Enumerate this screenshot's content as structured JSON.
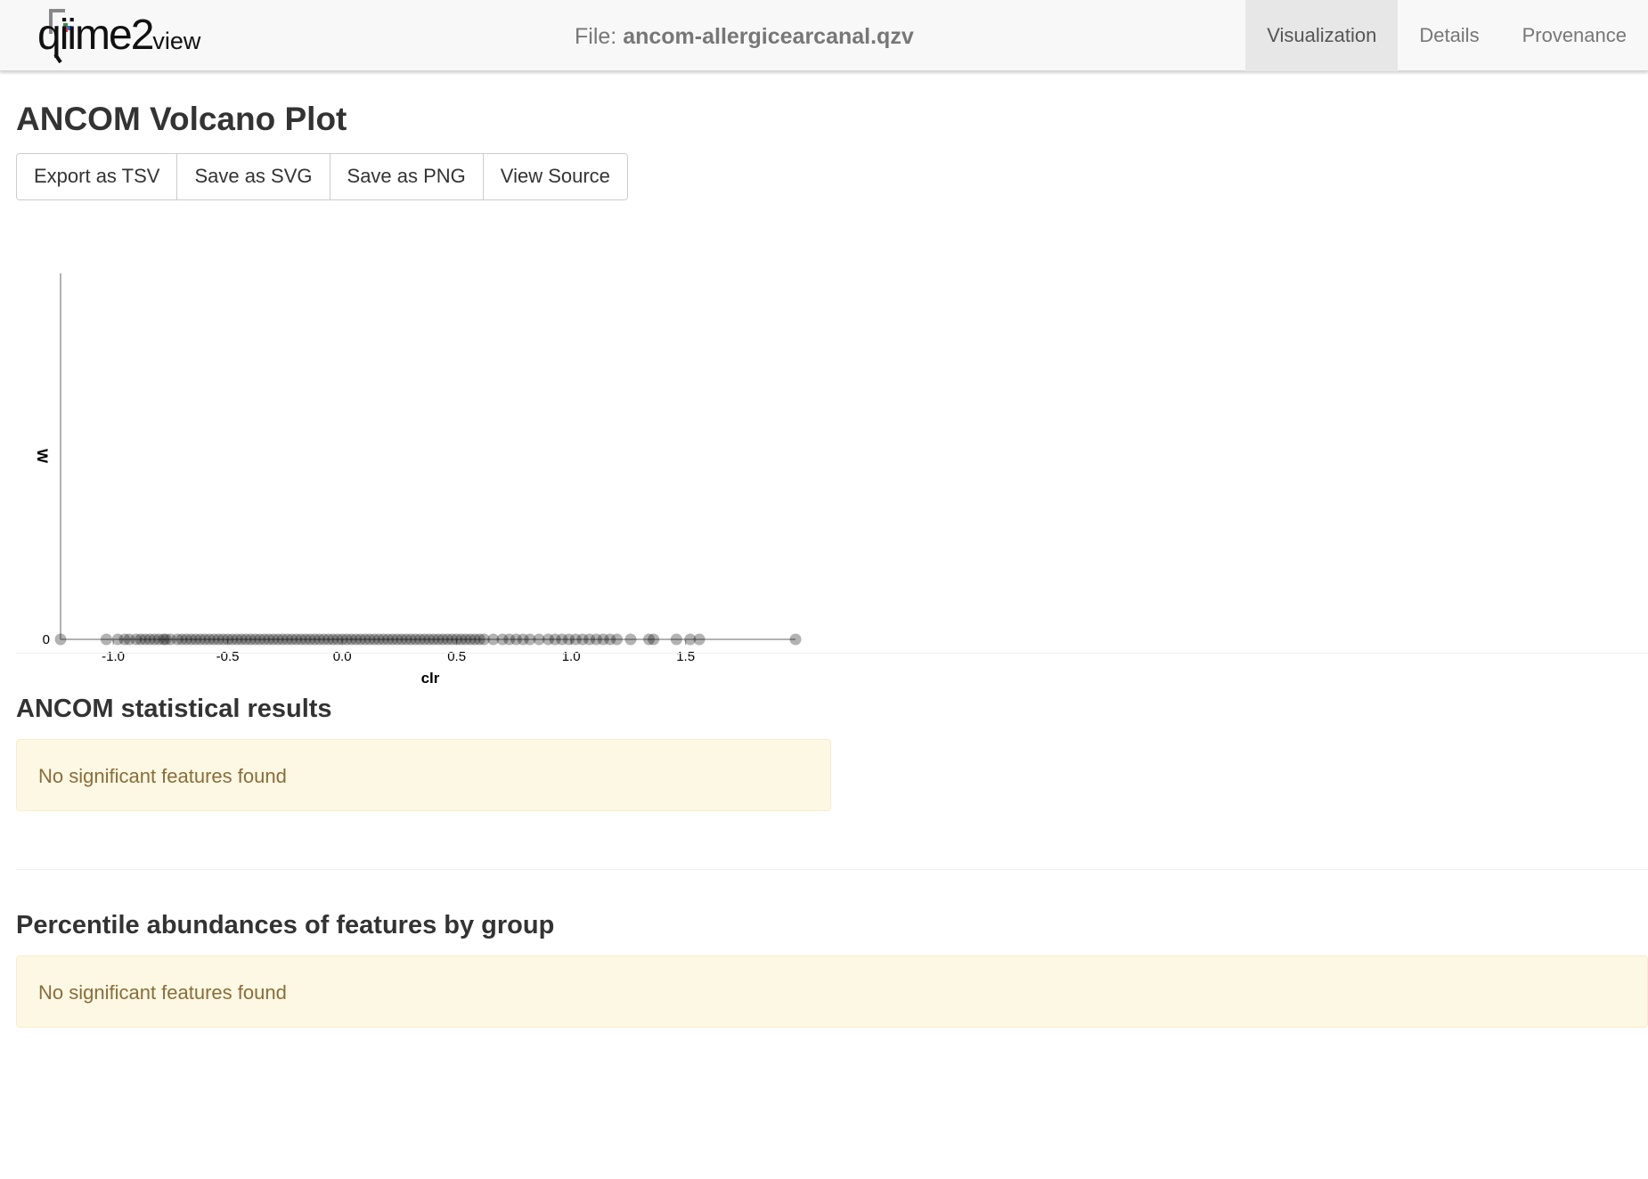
{
  "header": {
    "brand_main": "qiime",
    "brand_two": "2",
    "brand_view": "view",
    "file_prefix": "File:",
    "file_name": "ancom-allergicearcanal.qzv",
    "tabs": [
      {
        "label": "Visualization",
        "active": true
      },
      {
        "label": "Details",
        "active": false
      },
      {
        "label": "Provenance",
        "active": false
      }
    ]
  },
  "main": {
    "title": "ANCOM Volcano Plot",
    "toolbar": {
      "export_tsv": "Export as TSV",
      "save_svg": "Save as SVG",
      "save_png": "Save as PNG",
      "view_source": "View Source"
    },
    "stats_section": {
      "title": "ANCOM statistical results",
      "message": "No significant features found"
    },
    "percentile_section": {
      "title": "Percentile abundances of features by group",
      "message": "No significant features found"
    }
  },
  "colors": {
    "navbar_bg": "#f8f8f8",
    "active_tab_bg": "#e7e7e7",
    "alert_bg": "#fcf8e3",
    "alert_text": "#8a6d3b",
    "point": "#000000"
  },
  "chart_data": {
    "type": "scatter",
    "title": "",
    "xlabel": "clr",
    "ylabel": "W",
    "xlim": [
      -1.23,
      1.98
    ],
    "ylim": [
      0,
      1
    ],
    "x_ticks": [
      "-1.0",
      "-0.5",
      "0.0",
      "0.5",
      "1.0",
      "1.5"
    ],
    "y_ticks": [
      "0"
    ],
    "grid": false,
    "series": [
      {
        "x": [
          -1.23,
          -1.03,
          -0.98,
          -0.95,
          -0.93,
          -0.9,
          -0.88,
          -0.86,
          -0.84,
          -0.82,
          -0.8,
          -0.78,
          -0.77,
          -0.75,
          -0.72,
          -0.7,
          -0.68,
          -0.66,
          -0.64,
          -0.62,
          -0.6,
          -0.58,
          -0.56,
          -0.54,
          -0.52,
          -0.5,
          -0.48,
          -0.46,
          -0.44,
          -0.42,
          -0.4,
          -0.38,
          -0.36,
          -0.34,
          -0.32,
          -0.3,
          -0.28,
          -0.26,
          -0.24,
          -0.22,
          -0.2,
          -0.18,
          -0.16,
          -0.14,
          -0.12,
          -0.1,
          -0.08,
          -0.06,
          -0.04,
          -0.02,
          0.0,
          0.02,
          0.04,
          0.06,
          0.08,
          0.1,
          0.12,
          0.14,
          0.16,
          0.18,
          0.2,
          0.22,
          0.24,
          0.26,
          0.28,
          0.3,
          0.32,
          0.34,
          0.36,
          0.38,
          0.4,
          0.42,
          0.44,
          0.46,
          0.48,
          0.5,
          0.52,
          0.54,
          0.56,
          0.58,
          0.6,
          0.62,
          0.66,
          0.7,
          0.73,
          0.76,
          0.79,
          0.82,
          0.86,
          0.9,
          0.93,
          0.96,
          0.99,
          1.02,
          1.05,
          1.08,
          1.11,
          1.14,
          1.17,
          1.2,
          1.26,
          1.34,
          1.36,
          1.46,
          1.52,
          1.56,
          1.98
        ],
        "y": [
          0,
          0,
          0,
          0,
          0,
          0,
          0,
          0,
          0,
          0,
          0,
          0,
          0,
          0,
          0,
          0,
          0,
          0,
          0,
          0,
          0,
          0,
          0,
          0,
          0,
          0,
          0,
          0,
          0,
          0,
          0,
          0,
          0,
          0,
          0,
          0,
          0,
          0,
          0,
          0,
          0,
          0,
          0,
          0,
          0,
          0,
          0,
          0,
          0,
          0,
          0,
          0,
          0,
          0,
          0,
          0,
          0,
          0,
          0,
          0,
          0,
          0,
          0,
          0,
          0,
          0,
          0,
          0,
          0,
          0,
          0,
          0,
          0,
          0,
          0,
          0,
          0,
          0,
          0,
          0,
          0,
          0,
          0,
          0,
          0,
          0,
          0,
          0,
          0,
          0,
          0,
          0,
          0,
          0,
          0,
          0,
          0,
          0,
          0,
          0,
          0,
          0,
          0,
          0,
          0,
          0,
          0
        ]
      }
    ]
  }
}
